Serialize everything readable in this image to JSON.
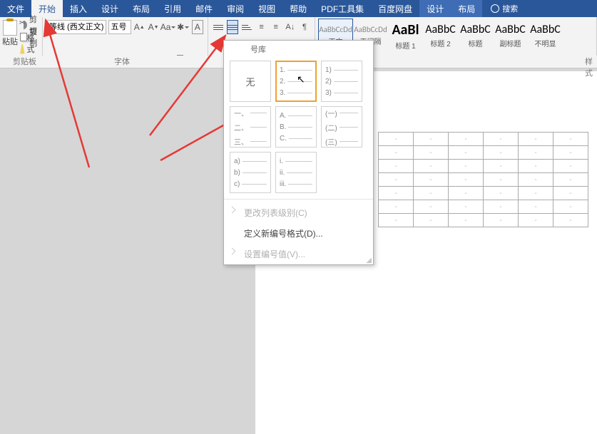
{
  "menu": {
    "file": "文件",
    "home": "开始",
    "insert": "插入",
    "design": "设计",
    "layout": "布局",
    "references": "引用",
    "mailings": "邮件",
    "review": "审阅",
    "view": "视图",
    "help": "帮助",
    "pdftools": "PDF工具集",
    "baidudisk": "百度网盘",
    "design2": "设计",
    "layout2": "布局",
    "search": "搜索"
  },
  "clipboard": {
    "paste": "粘贴",
    "cut": "剪切",
    "copy": "复制",
    "brush": "格式刷",
    "group_label": "剪贴板"
  },
  "font": {
    "family": "等线 (西文正文)",
    "size": "五号",
    "group_label": "字体"
  },
  "styles": {
    "group_label": "样式",
    "items": [
      {
        "preview": "AaBbCcDd",
        "name": "正文",
        "cls": "sm"
      },
      {
        "preview": "AaBbCcDd",
        "name": "无间隔",
        "cls": "sm"
      },
      {
        "preview": "AaBl",
        "name": "标题 1",
        "cls": "big"
      },
      {
        "preview": "AaBbC",
        "name": "标题 2",
        "cls": "mid"
      },
      {
        "preview": "AaBbC",
        "name": "标题",
        "cls": "mid"
      },
      {
        "preview": "AaBbC",
        "name": "副标题",
        "cls": "mid"
      },
      {
        "preview": "AaBbC",
        "name": "不明显",
        "cls": "mid"
      }
    ]
  },
  "numbering": {
    "library_label": "号库",
    "none": "无",
    "presets": {
      "numeric": [
        "1.",
        "2.",
        "3."
      ],
      "paren_num": [
        "1)",
        "2)",
        "3)"
      ],
      "chinese": [
        "一、",
        "二、",
        "三、"
      ],
      "alpha_upper": [
        "A.",
        "B.",
        "C."
      ],
      "chinese_paren": [
        "(一)",
        "(二)",
        "(三)"
      ],
      "alpha_lower_paren": [
        "a)",
        "b)",
        "c)"
      ],
      "roman_lower": [
        "i.",
        "ii.",
        "iii."
      ]
    },
    "change_level": "更改列表级别(C)",
    "define_format": "定义新编号格式(D)...",
    "set_value": "设置编号值(V)..."
  }
}
